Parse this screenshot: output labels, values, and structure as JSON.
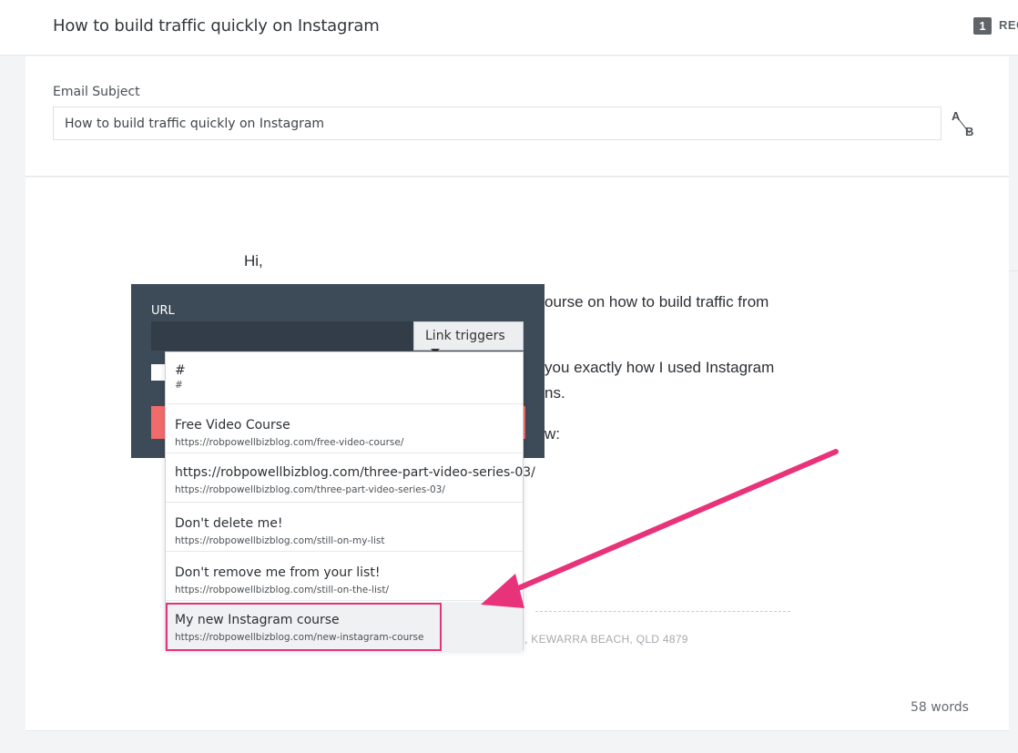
{
  "header": {
    "title": "How to build traffic quickly on Instagram",
    "badge_count": "1",
    "badge_text": "REC"
  },
  "subject": {
    "label": "Email Subject",
    "value": "How to build traffic quickly on Instagram",
    "ab_a": "A",
    "ab_b": "B"
  },
  "email": {
    "greeting": "Hi,",
    "line1": "ourse on how to build traffic from",
    "line2a": "you exactly how I used Instagram",
    "line2b": "ns.",
    "line3": "w:",
    "footer_address": ", KEWARRA BEACH, QLD 4879",
    "word_count": "58 words"
  },
  "link_popup": {
    "url_label": "URL",
    "url_value": "",
    "link_triggers_label": "Link triggers"
  },
  "link_options": [
    {
      "name": "#",
      "url": "#"
    },
    {
      "name": "Free Video Course",
      "url": "https://robpowellbizblog.com/free-video-course/"
    },
    {
      "name": "https://robpowellbizblog.com/three-part-video-series-03/",
      "url": "https://robpowellbizblog.com/three-part-video-series-03/"
    },
    {
      "name": "Don't delete me!",
      "url": "https://robpowellbizblog.com/still-on-my-list"
    },
    {
      "name": "Don't remove me from your list!",
      "url": "https://robpowellbizblog.com/still-on-the-list/"
    },
    {
      "name": "My new Instagram course",
      "url": "https://robpowellbizblog.com/new-instagram-course"
    }
  ],
  "colors": {
    "popup_bg": "#3d4a57",
    "highlight": "#e8337a",
    "arrow": "#e8337a"
  }
}
